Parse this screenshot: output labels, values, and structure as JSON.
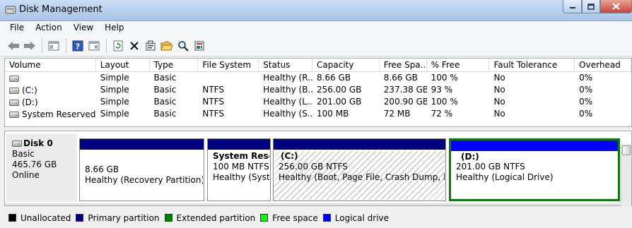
{
  "window": {
    "title": "Disk Management",
    "minimize": "0",
    "maximize": "1",
    "close": "r"
  },
  "menu": [
    "File",
    "Action",
    "View",
    "Help"
  ],
  "toolbar": [
    "back-icon",
    "forward-icon",
    "show-hide-console-tree-icon",
    "help-icon",
    "properties-pane-icon",
    "refresh-icon",
    "delete-icon",
    "properties-icon",
    "open-folder-icon",
    "search-icon",
    "settings-icon"
  ],
  "volume_list": {
    "columns": [
      "Volume",
      "Layout",
      "Type",
      "File System",
      "Status",
      "Capacity",
      "Free Spa...",
      "% Free",
      "Fault Tolerance",
      "Overhead"
    ],
    "rows": [
      [
        "",
        "Simple",
        "Basic",
        "",
        "Healthy (R...",
        "8.66 GB",
        "8.66 GB",
        "100 %",
        "No",
        "0%"
      ],
      [
        "(C:)",
        "Simple",
        "Basic",
        "NTFS",
        "Healthy (B...",
        "256.00 GB",
        "237.38 GB",
        "93 %",
        "No",
        "0%"
      ],
      [
        "(D:)",
        "Simple",
        "Basic",
        "NTFS",
        "Healthy (L...",
        "201.00 GB",
        "200.90 GB",
        "100 %",
        "No",
        "0%"
      ],
      [
        "System Reserved",
        "Simple",
        "Basic",
        "NTFS",
        "Healthy (S...",
        "100 MB",
        "72 MB",
        "72 %",
        "No",
        "0%"
      ]
    ]
  },
  "disk": {
    "name": "Disk 0",
    "type": "Basic",
    "size": "465.76 GB",
    "state": "Online"
  },
  "partitions": [
    {
      "title": "",
      "size": "8.66 GB",
      "status": "Healthy (Recovery Partition)"
    },
    {
      "title": "System Reser",
      "size": "100 MB NTFS",
      "status": "Healthy (Syste"
    },
    {
      "title": "(C:)",
      "size": "256.00 GB NTFS",
      "status": "Healthy (Boot, Page File, Crash Dump, Prima"
    },
    {
      "title": "(D:)",
      "size": "201.00 GB NTFS",
      "status": "Healthy (Logical Drive)"
    }
  ],
  "legend": [
    {
      "label": "Unallocated",
      "color": "#000000"
    },
    {
      "label": "Primary partition",
      "color": "#000080"
    },
    {
      "label": "Extended partition",
      "color": "#008000"
    },
    {
      "label": "Free space",
      "color": "#00ff00"
    },
    {
      "label": "Logical drive",
      "color": "#0000ff"
    }
  ]
}
